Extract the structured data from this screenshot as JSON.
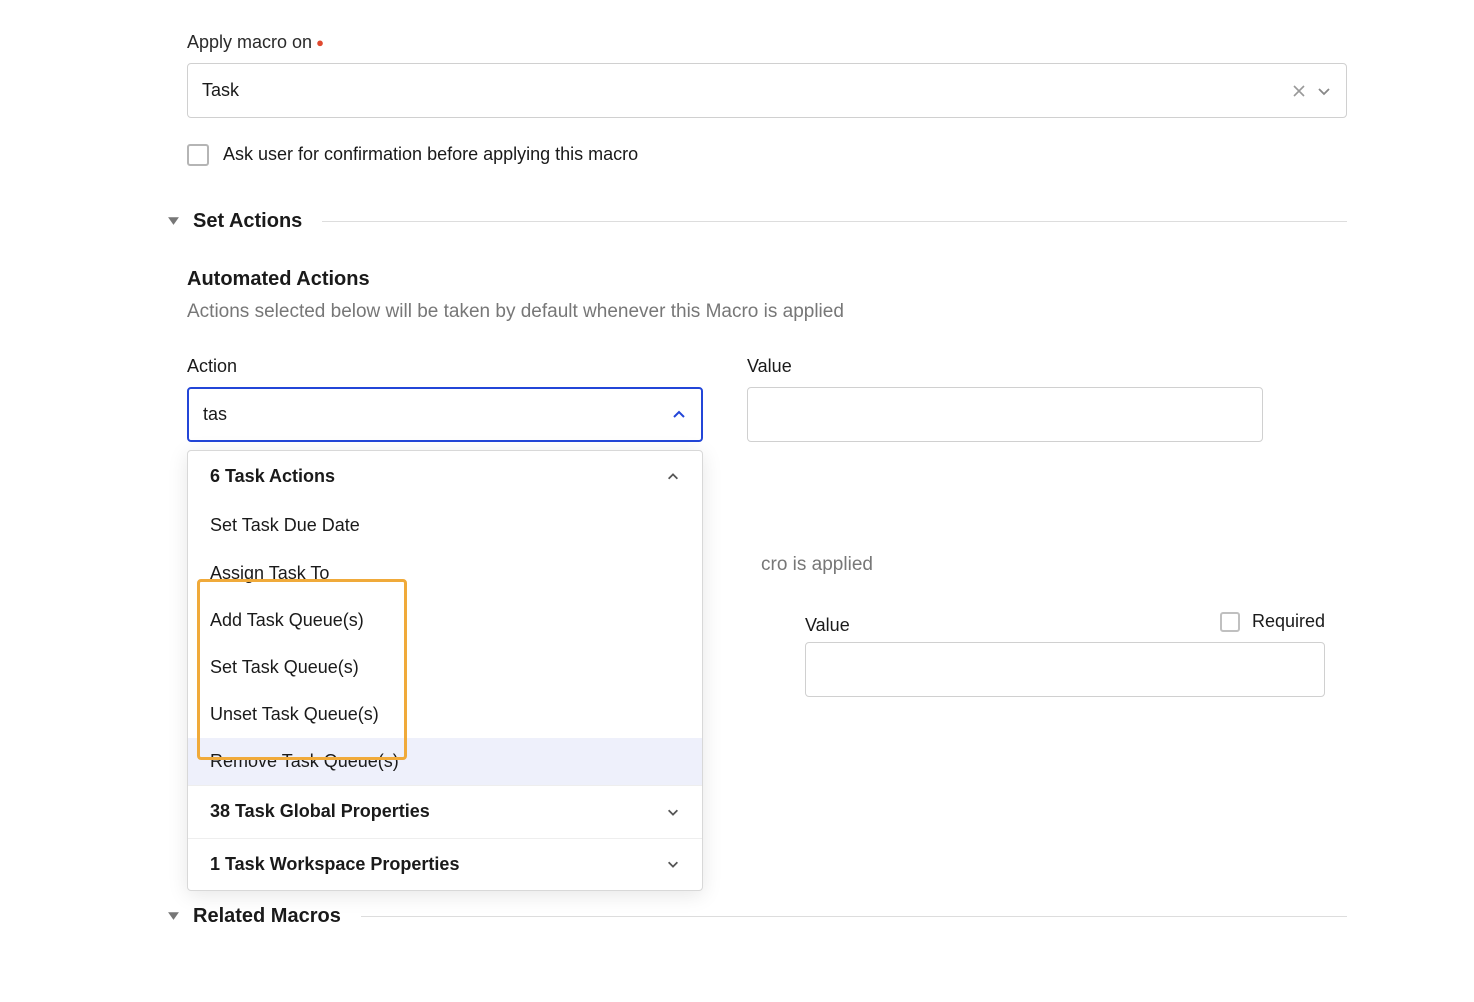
{
  "apply_on": {
    "label": "Apply macro on",
    "value": "Task"
  },
  "confirm": {
    "label": "Ask user for confirmation before applying this macro"
  },
  "set_actions": {
    "title": "Set Actions",
    "automated": {
      "heading": "Automated Actions",
      "description": "Actions selected below will be taken by default whenever this Macro is applied",
      "action_label": "Action",
      "value_label": "Value",
      "action_input": "tas",
      "dropdown": {
        "group_open": "6 Task Actions",
        "items": [
          "Set Task Due Date",
          "Assign Task To",
          "Add Task Queue(s)",
          "Set Task Queue(s)",
          "Unset Task Queue(s)",
          "Remove Task Queue(s)"
        ],
        "group_closed_1": "38 Task Global Properties",
        "group_closed_2": "1 Task Workspace Properties"
      }
    },
    "secondary": {
      "desc_visible_tail": "cro is applied",
      "value_label": "Value",
      "required_label": "Required"
    }
  },
  "related_macros": {
    "title": "Related Macros"
  }
}
